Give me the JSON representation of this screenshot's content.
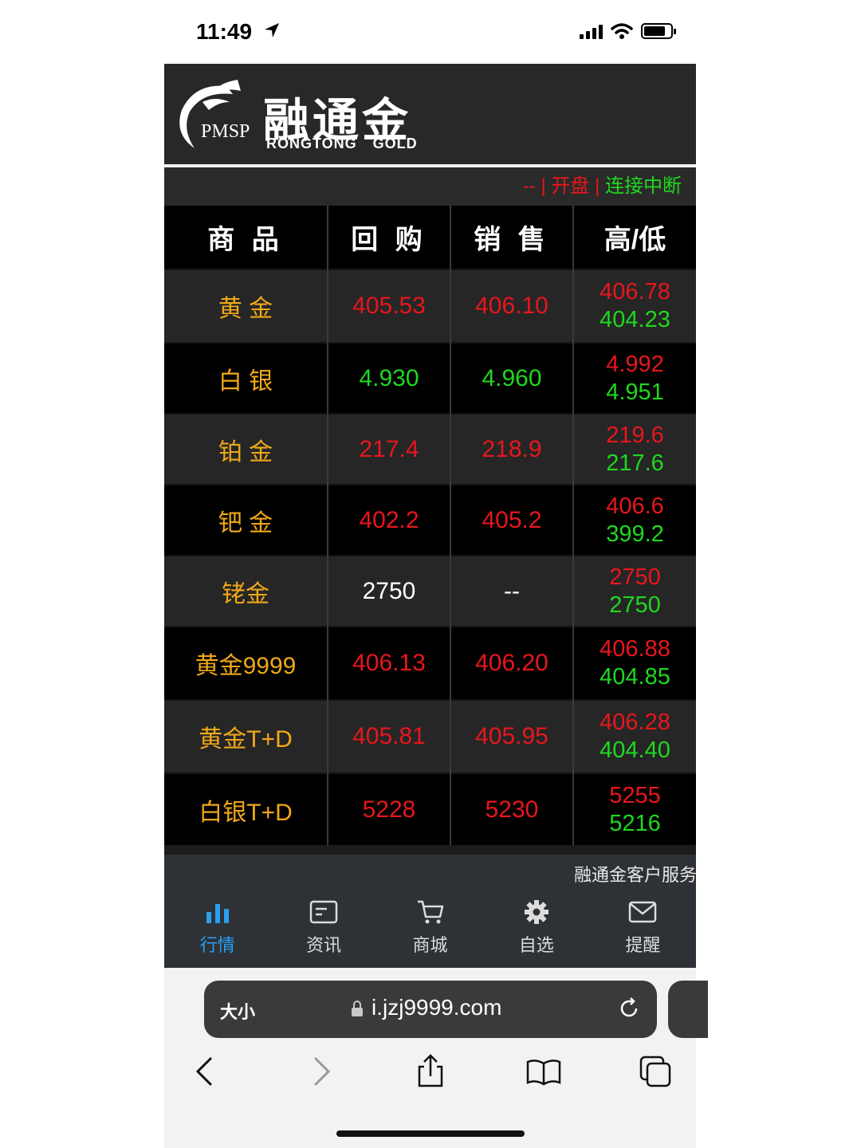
{
  "status_bar": {
    "time": "11:49"
  },
  "logo": {
    "mark_text": "PMSP",
    "cn_name": "融通金",
    "en_name": "RONGTONG GOLD"
  },
  "connection": {
    "dash": "--",
    "sep1": "|",
    "state1": "开盘",
    "sep2": "|",
    "state2": "连接中断"
  },
  "table": {
    "headers": [
      "商 品",
      "回 购",
      "销 售",
      "高/低"
    ],
    "rows": [
      {
        "name": "黄 金",
        "buy": "405.53",
        "sell": "406.10",
        "high": "406.78",
        "low": "404.23"
      },
      {
        "name": "白 银",
        "buy": "4.930",
        "sell": "4.960",
        "high": "4.992",
        "low": "4.951"
      },
      {
        "name": "铂 金",
        "buy": "217.4",
        "sell": "218.9",
        "high": "219.6",
        "low": "217.6"
      },
      {
        "name": "钯 金",
        "buy": "402.2",
        "sell": "405.2",
        "high": "406.6",
        "low": "399.2"
      },
      {
        "name": "铑金",
        "buy": "2750",
        "sell": "--",
        "high": "2750",
        "low": "2750"
      },
      {
        "name": "黄金9999",
        "buy": "406.13",
        "sell": "406.20",
        "high": "406.88",
        "low": "404.85"
      },
      {
        "name": "黄金T+D",
        "buy": "405.81",
        "sell": "405.95",
        "high": "406.28",
        "low": "404.40"
      },
      {
        "name": "白银T+D",
        "buy": "5228",
        "sell": "5230",
        "high": "5255",
        "low": "5216"
      }
    ]
  },
  "service": {
    "text": "融通金客户服务"
  },
  "tabs": [
    {
      "label": "行情",
      "icon": "bar-chart-icon",
      "active": true
    },
    {
      "label": "资讯",
      "icon": "news-card-icon",
      "active": false
    },
    {
      "label": "商城",
      "icon": "cart-icon",
      "active": false
    },
    {
      "label": "自选",
      "icon": "gear-icon",
      "active": false
    },
    {
      "label": "提醒",
      "icon": "mail-icon",
      "active": false
    }
  ],
  "safari": {
    "text_size_label": "大小",
    "url": "i.jzj9999.com"
  },
  "colors": {
    "up": "#e8161c",
    "down": "#1fd81f",
    "name": "#f0a818",
    "active_tab": "#2a9ff2"
  }
}
